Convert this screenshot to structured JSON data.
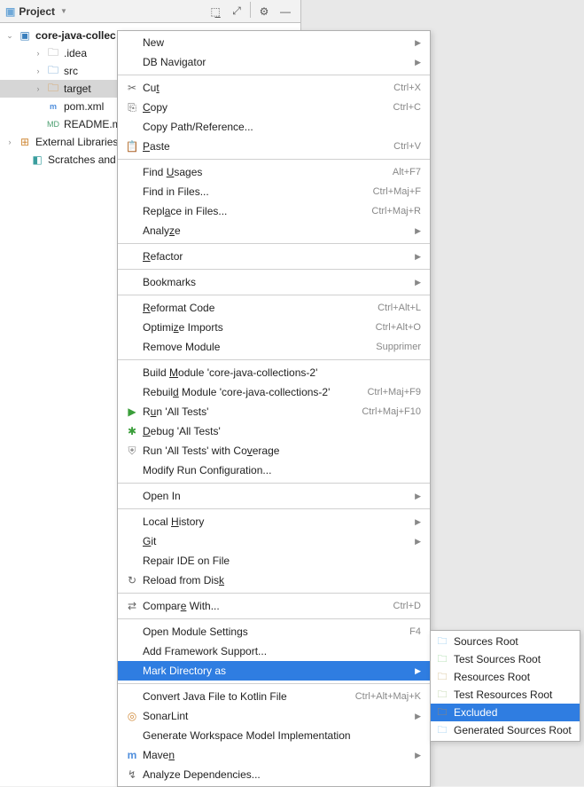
{
  "panel": {
    "title": "Project",
    "tree": {
      "root": "core-java-collec",
      "items": [
        {
          "arrow": "›",
          "label": ".idea",
          "cls": "folder-icon"
        },
        {
          "arrow": "›",
          "label": "src",
          "cls": "folder-blue"
        },
        {
          "arrow": "›",
          "label": "target",
          "cls": "folder-orange",
          "sel": true
        },
        {
          "arrow": "",
          "label": "pom.xml",
          "cls": "file-m",
          "iconText": "m"
        },
        {
          "arrow": "",
          "label": "README.md",
          "cls": "file-md",
          "iconText": "MD"
        }
      ],
      "ext": "External Libraries",
      "scratch": "Scratches and Co"
    }
  },
  "menu": [
    {
      "icon": "",
      "label": "New",
      "arrow": true
    },
    {
      "icon": "",
      "label": "DB Navigator",
      "arrow": true
    },
    {
      "sep": true
    },
    {
      "icon": "✂",
      "label": "Cu<u>t</u>",
      "sc": "Ctrl+X"
    },
    {
      "icon": "⎘",
      "label": "<u>C</u>opy",
      "sc": "Ctrl+C"
    },
    {
      "icon": "",
      "label": "Copy Path/Reference..."
    },
    {
      "icon": "📋",
      "label": "<u>P</u>aste",
      "sc": "Ctrl+V"
    },
    {
      "sep": true
    },
    {
      "icon": "",
      "label": "Find <u>U</u>sages",
      "sc": "Alt+F7"
    },
    {
      "icon": "",
      "label": "Find in Files...",
      "sc": "Ctrl+Maj+F"
    },
    {
      "icon": "",
      "label": "Repl<u>a</u>ce in Files...",
      "sc": "Ctrl+Maj+R"
    },
    {
      "icon": "",
      "label": "Analy<u>z</u>e",
      "arrow": true
    },
    {
      "sep": true
    },
    {
      "icon": "",
      "label": "<u>R</u>efactor",
      "arrow": true
    },
    {
      "sep": true
    },
    {
      "icon": "",
      "label": "Bookmarks",
      "arrow": true
    },
    {
      "sep": true
    },
    {
      "icon": "",
      "label": "<u>R</u>eformat Code",
      "sc": "Ctrl+Alt+L"
    },
    {
      "icon": "",
      "label": "Optimi<u>z</u>e Imports",
      "sc": "Ctrl+Alt+O"
    },
    {
      "icon": "",
      "label": "Remove Module",
      "sc": "Supprimer"
    },
    {
      "sep": true
    },
    {
      "icon": "",
      "label": "Build <u>M</u>odule 'core-java-collections-2'"
    },
    {
      "icon": "",
      "label": "Rebuil<u>d</u> Module 'core-java-collections-2'",
      "sc": "Ctrl+Maj+F9"
    },
    {
      "icon": "▶",
      "iconColor": "#3a9e3a",
      "label": "R<u>u</u>n 'All Tests'",
      "sc": "Ctrl+Maj+F10"
    },
    {
      "icon": "✱",
      "iconColor": "#3a9e3a",
      "label": "<u>D</u>ebug 'All Tests'"
    },
    {
      "icon": "⛨",
      "iconColor": "#888",
      "label": "Run 'All Tests' with Co<u>v</u>erage"
    },
    {
      "icon": "",
      "label": "Modify Run Configuration..."
    },
    {
      "sep": true
    },
    {
      "icon": "",
      "label": "Open In",
      "arrow": true
    },
    {
      "sep": true
    },
    {
      "icon": "",
      "label": "Local <u>H</u>istory",
      "arrow": true
    },
    {
      "icon": "",
      "label": "<u>G</u>it",
      "arrow": true
    },
    {
      "icon": "",
      "label": "Repair IDE on File"
    },
    {
      "icon": "↻",
      "label": "Reload from Dis<u>k</u>"
    },
    {
      "sep": true
    },
    {
      "icon": "⇄",
      "label": "Compar<u>e</u> With...",
      "sc": "Ctrl+D"
    },
    {
      "sep": true
    },
    {
      "icon": "",
      "label": "Open Module Settings",
      "sc": "F4"
    },
    {
      "icon": "",
      "label": "Add Framework Support..."
    },
    {
      "icon": "",
      "label": "Mark Directory as",
      "arrow": true,
      "highlight": true
    },
    {
      "sep": true
    },
    {
      "icon": "",
      "label": "Convert Java File to Kotlin File",
      "sc": "Ctrl+Alt+Maj+K"
    },
    {
      "icon": "◎",
      "iconColor": "#d08a3a",
      "label": "SonarLint",
      "arrow": true
    },
    {
      "icon": "",
      "label": "Generate Workspace Model Implementation"
    },
    {
      "icon": "m",
      "iconColor": "#4f8edc",
      "bold": true,
      "label": "Mave<u>n</u>",
      "arrow": true
    },
    {
      "icon": "↯",
      "label": "Analyze Dependencies..."
    }
  ],
  "submenu": [
    {
      "color": "#6fb8e8",
      "label": "Sources Root"
    },
    {
      "color": "#7cc97c",
      "label": "Test Sources Root"
    },
    {
      "color": "#c0a060",
      "label": "Resources Root"
    },
    {
      "color": "#a0c080",
      "label": "Test Resources Root"
    },
    {
      "color": "#d68a2e",
      "label": "Excluded",
      "highlight": true
    },
    {
      "color": "#6fb8e8",
      "label": "Generated Sources Root"
    }
  ]
}
